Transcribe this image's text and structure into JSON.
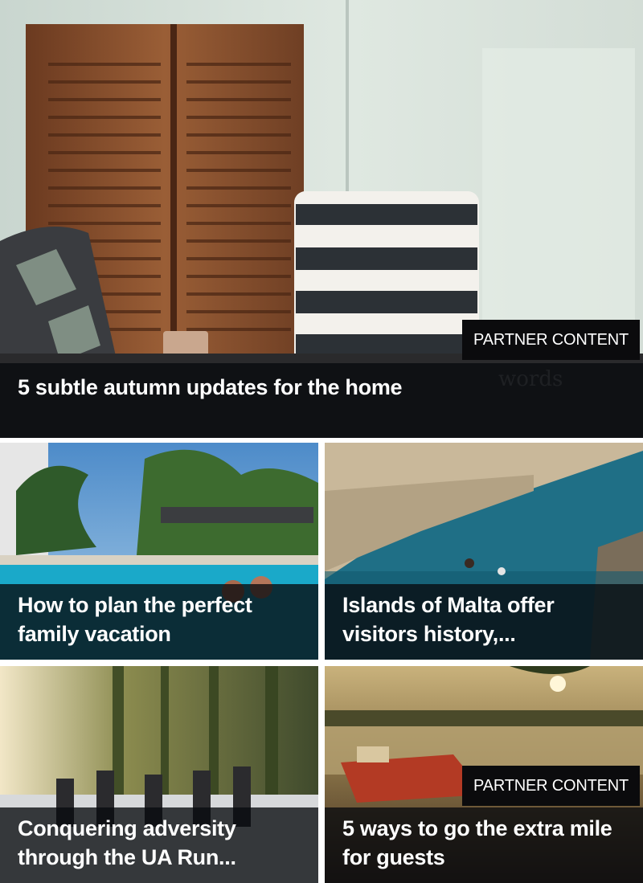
{
  "colors": {
    "caption_bg": "#0a0c10",
    "badge_bg": "#0b0b0d",
    "text": "#ffffff"
  },
  "hero": {
    "title": "5 subtle autumn updates for the home",
    "badge": "PARTNER CONTENT",
    "image_watermark": "words"
  },
  "grid": [
    {
      "title": "How to plan the perfect family vacation",
      "badge": ""
    },
    {
      "title": "Islands of Malta offer visitors history,...",
      "badge": ""
    },
    {
      "title": "Conquering adversity through the UA Run...",
      "badge": ""
    },
    {
      "title": "5 ways to go the extra mile for guests",
      "badge": "PARTNER CONTENT"
    }
  ]
}
